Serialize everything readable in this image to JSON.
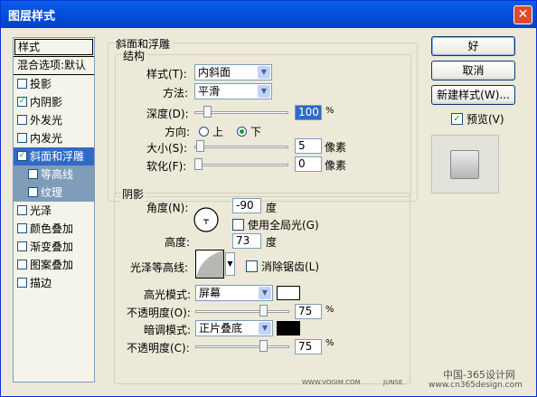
{
  "window": {
    "title": "图层样式"
  },
  "styles_list": {
    "header": "样式",
    "blend_options": "混合选项:默认",
    "items": [
      {
        "label": "投影",
        "checked": false
      },
      {
        "label": "内阴影",
        "checked": true
      },
      {
        "label": "外发光",
        "checked": false
      },
      {
        "label": "内发光",
        "checked": false
      },
      {
        "label": "斜面和浮雕",
        "checked": true,
        "selected": true
      },
      {
        "label": "等高线",
        "checked": false,
        "sub": true
      },
      {
        "label": "纹理",
        "checked": false,
        "sub": true
      },
      {
        "label": "光泽",
        "checked": false
      },
      {
        "label": "颜色叠加",
        "checked": false
      },
      {
        "label": "渐变叠加",
        "checked": false
      },
      {
        "label": "图案叠加",
        "checked": false
      },
      {
        "label": "描边",
        "checked": false
      }
    ]
  },
  "bevel": {
    "title": "斜面和浮雕",
    "structure_title": "结构",
    "style_label": "样式(T):",
    "style_value": "内斜面",
    "technique_label": "方法:",
    "technique_value": "平滑",
    "depth_label": "深度(D):",
    "depth_value": "100",
    "depth_unit": "%",
    "depth_fraction": 0.1,
    "direction_label": "方向:",
    "direction_up": "上",
    "direction_down": "下",
    "direction_selected": "下",
    "size_label": "大小(S):",
    "size_value": "5",
    "size_unit": "像素",
    "size_fraction": 0.02,
    "soften_label": "软化(F):",
    "soften_value": "0",
    "soften_unit": "像素",
    "soften_fraction": 0.0
  },
  "shading": {
    "title": "阴影",
    "angle_label": "角度(N):",
    "angle_value": "-90",
    "angle_unit": "度",
    "global_light_label": "使用全局光(G)",
    "global_light_checked": false,
    "altitude_label": "高度:",
    "altitude_value": "73",
    "altitude_unit": "度",
    "gloss_label": "光泽等高线:",
    "antialias_label": "消除锯齿(L)",
    "antialias_checked": false,
    "highlight_mode_label": "高光模式:",
    "highlight_mode_value": "屏幕",
    "highlight_color": "#FFFFFF",
    "highlight_opacity_label": "不透明度(O):",
    "highlight_opacity_value": "75",
    "highlight_opacity_fraction": 0.75,
    "shadow_mode_label": "暗调模式:",
    "shadow_mode_value": "正片叠底",
    "shadow_color": "#000000",
    "shadow_opacity_label": "不透明度(C):",
    "shadow_opacity_value": "75",
    "shadow_opacity_fraction": 0.75,
    "percent": "%"
  },
  "buttons": {
    "ok": "好",
    "cancel": "取消",
    "new_style": "新建样式(W)...",
    "preview_label": "预览(V)",
    "preview_checked": true
  },
  "watermarks": {
    "site1": "WWW.VOGIM.COM",
    "site2": "JUNSE",
    "site3": "中国-365设计网",
    "site4": "www.cn365design.com"
  }
}
